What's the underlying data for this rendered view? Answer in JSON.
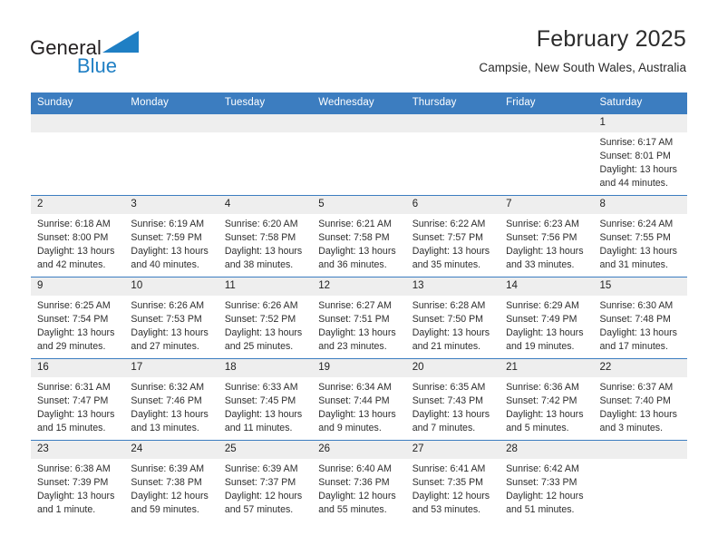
{
  "brand": {
    "name_part1": "General",
    "name_part2": "Blue",
    "logo_icon": "triangle-logo-icon",
    "accent_color": "#1f7fc4"
  },
  "header": {
    "title": "February 2025",
    "location": "Campsie, New South Wales, Australia"
  },
  "calendar": {
    "header_bg": "#3c7dc0",
    "daynum_bg": "#eeeeee",
    "weekdays": [
      "Sunday",
      "Monday",
      "Tuesday",
      "Wednesday",
      "Thursday",
      "Friday",
      "Saturday"
    ],
    "weeks": [
      [
        {
          "day": "",
          "sunrise": "",
          "sunset": "",
          "daylight": ""
        },
        {
          "day": "",
          "sunrise": "",
          "sunset": "",
          "daylight": ""
        },
        {
          "day": "",
          "sunrise": "",
          "sunset": "",
          "daylight": ""
        },
        {
          "day": "",
          "sunrise": "",
          "sunset": "",
          "daylight": ""
        },
        {
          "day": "",
          "sunrise": "",
          "sunset": "",
          "daylight": ""
        },
        {
          "day": "",
          "sunrise": "",
          "sunset": "",
          "daylight": ""
        },
        {
          "day": "1",
          "sunrise": "Sunrise: 6:17 AM",
          "sunset": "Sunset: 8:01 PM",
          "daylight": "Daylight: 13 hours and 44 minutes."
        }
      ],
      [
        {
          "day": "2",
          "sunrise": "Sunrise: 6:18 AM",
          "sunset": "Sunset: 8:00 PM",
          "daylight": "Daylight: 13 hours and 42 minutes."
        },
        {
          "day": "3",
          "sunrise": "Sunrise: 6:19 AM",
          "sunset": "Sunset: 7:59 PM",
          "daylight": "Daylight: 13 hours and 40 minutes."
        },
        {
          "day": "4",
          "sunrise": "Sunrise: 6:20 AM",
          "sunset": "Sunset: 7:58 PM",
          "daylight": "Daylight: 13 hours and 38 minutes."
        },
        {
          "day": "5",
          "sunrise": "Sunrise: 6:21 AM",
          "sunset": "Sunset: 7:58 PM",
          "daylight": "Daylight: 13 hours and 36 minutes."
        },
        {
          "day": "6",
          "sunrise": "Sunrise: 6:22 AM",
          "sunset": "Sunset: 7:57 PM",
          "daylight": "Daylight: 13 hours and 35 minutes."
        },
        {
          "day": "7",
          "sunrise": "Sunrise: 6:23 AM",
          "sunset": "Sunset: 7:56 PM",
          "daylight": "Daylight: 13 hours and 33 minutes."
        },
        {
          "day": "8",
          "sunrise": "Sunrise: 6:24 AM",
          "sunset": "Sunset: 7:55 PM",
          "daylight": "Daylight: 13 hours and 31 minutes."
        }
      ],
      [
        {
          "day": "9",
          "sunrise": "Sunrise: 6:25 AM",
          "sunset": "Sunset: 7:54 PM",
          "daylight": "Daylight: 13 hours and 29 minutes."
        },
        {
          "day": "10",
          "sunrise": "Sunrise: 6:26 AM",
          "sunset": "Sunset: 7:53 PM",
          "daylight": "Daylight: 13 hours and 27 minutes."
        },
        {
          "day": "11",
          "sunrise": "Sunrise: 6:26 AM",
          "sunset": "Sunset: 7:52 PM",
          "daylight": "Daylight: 13 hours and 25 minutes."
        },
        {
          "day": "12",
          "sunrise": "Sunrise: 6:27 AM",
          "sunset": "Sunset: 7:51 PM",
          "daylight": "Daylight: 13 hours and 23 minutes."
        },
        {
          "day": "13",
          "sunrise": "Sunrise: 6:28 AM",
          "sunset": "Sunset: 7:50 PM",
          "daylight": "Daylight: 13 hours and 21 minutes."
        },
        {
          "day": "14",
          "sunrise": "Sunrise: 6:29 AM",
          "sunset": "Sunset: 7:49 PM",
          "daylight": "Daylight: 13 hours and 19 minutes."
        },
        {
          "day": "15",
          "sunrise": "Sunrise: 6:30 AM",
          "sunset": "Sunset: 7:48 PM",
          "daylight": "Daylight: 13 hours and 17 minutes."
        }
      ],
      [
        {
          "day": "16",
          "sunrise": "Sunrise: 6:31 AM",
          "sunset": "Sunset: 7:47 PM",
          "daylight": "Daylight: 13 hours and 15 minutes."
        },
        {
          "day": "17",
          "sunrise": "Sunrise: 6:32 AM",
          "sunset": "Sunset: 7:46 PM",
          "daylight": "Daylight: 13 hours and 13 minutes."
        },
        {
          "day": "18",
          "sunrise": "Sunrise: 6:33 AM",
          "sunset": "Sunset: 7:45 PM",
          "daylight": "Daylight: 13 hours and 11 minutes."
        },
        {
          "day": "19",
          "sunrise": "Sunrise: 6:34 AM",
          "sunset": "Sunset: 7:44 PM",
          "daylight": "Daylight: 13 hours and 9 minutes."
        },
        {
          "day": "20",
          "sunrise": "Sunrise: 6:35 AM",
          "sunset": "Sunset: 7:43 PM",
          "daylight": "Daylight: 13 hours and 7 minutes."
        },
        {
          "day": "21",
          "sunrise": "Sunrise: 6:36 AM",
          "sunset": "Sunset: 7:42 PM",
          "daylight": "Daylight: 13 hours and 5 minutes."
        },
        {
          "day": "22",
          "sunrise": "Sunrise: 6:37 AM",
          "sunset": "Sunset: 7:40 PM",
          "daylight": "Daylight: 13 hours and 3 minutes."
        }
      ],
      [
        {
          "day": "23",
          "sunrise": "Sunrise: 6:38 AM",
          "sunset": "Sunset: 7:39 PM",
          "daylight": "Daylight: 13 hours and 1 minute."
        },
        {
          "day": "24",
          "sunrise": "Sunrise: 6:39 AM",
          "sunset": "Sunset: 7:38 PM",
          "daylight": "Daylight: 12 hours and 59 minutes."
        },
        {
          "day": "25",
          "sunrise": "Sunrise: 6:39 AM",
          "sunset": "Sunset: 7:37 PM",
          "daylight": "Daylight: 12 hours and 57 minutes."
        },
        {
          "day": "26",
          "sunrise": "Sunrise: 6:40 AM",
          "sunset": "Sunset: 7:36 PM",
          "daylight": "Daylight: 12 hours and 55 minutes."
        },
        {
          "day": "27",
          "sunrise": "Sunrise: 6:41 AM",
          "sunset": "Sunset: 7:35 PM",
          "daylight": "Daylight: 12 hours and 53 minutes."
        },
        {
          "day": "28",
          "sunrise": "Sunrise: 6:42 AM",
          "sunset": "Sunset: 7:33 PM",
          "daylight": "Daylight: 12 hours and 51 minutes."
        },
        {
          "day": "",
          "sunrise": "",
          "sunset": "",
          "daylight": ""
        }
      ]
    ]
  }
}
